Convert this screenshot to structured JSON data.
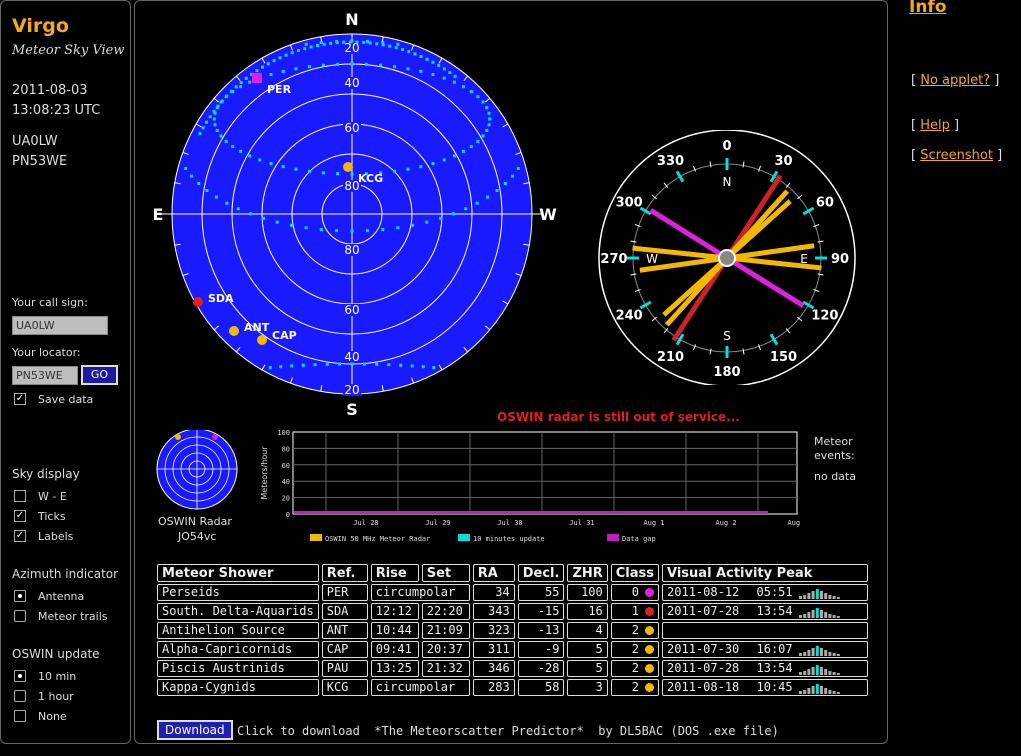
{
  "sidebar": {
    "app_name": "Virgo",
    "app_subtitle": "Meteor Sky View",
    "date": "2011-08-03",
    "time": "13:08:23 UTC",
    "callsign": "UA0LW",
    "locator": "PN53WE",
    "call_sign_label": "Your call sign:",
    "call_sign_value": "UA0LW",
    "locator_label": "Your locator:",
    "locator_value": "PN53WE",
    "go_label": "GO",
    "save_label": "Save data",
    "sky_display_label": "Sky display",
    "sky_options": [
      {
        "label": "W - E",
        "checked": false
      },
      {
        "label": "Ticks",
        "checked": true
      },
      {
        "label": "Labels",
        "checked": true
      }
    ],
    "azimuth_label": "Azimuth indicator",
    "azimuth_options": [
      {
        "label": "Antenna",
        "selected": true
      },
      {
        "label": "Meteor trails",
        "selected": false
      }
    ],
    "oswin_update_label": "OSWIN update",
    "oswin_options": [
      {
        "label": "10 min",
        "selected": true
      },
      {
        "label": "1 hour",
        "selected": false
      },
      {
        "label": "None",
        "selected": false
      }
    ]
  },
  "right": {
    "info_label": "Info",
    "no_applet": "No applet?",
    "help": "Help",
    "screenshot": "Screenshot"
  },
  "skymap": {
    "directions": {
      "n": "N",
      "s": "S",
      "e": "E",
      "w": "W"
    },
    "elevation_labels": [
      "20",
      "40",
      "60",
      "80",
      "80",
      "60",
      "40",
      "20"
    ],
    "radiants": [
      {
        "code": "PER",
        "color": "#e020e0"
      },
      {
        "code": "KCG",
        "color": "#f5b800"
      },
      {
        "code": "SDA",
        "color": "#e02020"
      },
      {
        "code": "ANT",
        "color": "#f5b800"
      },
      {
        "code": "CAP",
        "color": "#f5b800"
      }
    ],
    "colors": {
      "sky": "#1a1aff",
      "grid": "#ffffff",
      "track": "#00e0e0"
    }
  },
  "compass": {
    "degree_labels": [
      "0",
      "30",
      "60",
      "90",
      "120",
      "150",
      "180",
      "210",
      "240",
      "270",
      "300",
      "330"
    ],
    "inner_labels": {
      "n": "N",
      "e": "E",
      "s": "S",
      "w": "W"
    },
    "trails": [
      {
        "name": "magenta",
        "color": "#e020e0"
      },
      {
        "name": "red",
        "color": "#d0202a"
      },
      {
        "name": "yellow",
        "color": "#f5b800"
      }
    ]
  },
  "oswin": {
    "status": "OSWIN radar is still out of service...",
    "radar_label": "OSWIN Radar",
    "radar_locator": "JO54vc",
    "y_axis_label": "Meteors/hour",
    "y_ticks": [
      "100",
      "80",
      "60",
      "40",
      "20",
      "0"
    ],
    "x_ticks": [
      "Jul 28",
      "Jul 29",
      "Jul 30",
      "Jul 31",
      "Aug 1",
      "Aug 2",
      "Aug 3"
    ],
    "legend": [
      {
        "label": "OSWIN 50 MHz Meteor Radar",
        "color": "#f5b800"
      },
      {
        "label": "10 minutes update",
        "color": "#00e0e0"
      },
      {
        "label": "Data gap",
        "color": "#c020c0"
      }
    ],
    "events_label": "Meteor events:",
    "events_value": "no data"
  },
  "table": {
    "headers": [
      "Meteor Shower",
      "Ref.",
      "Rise",
      "Set",
      "RA",
      "Decl.",
      "ZHR",
      "Class",
      "Visual Activity Peak"
    ],
    "rows": [
      {
        "name": "Perseids",
        "ref": "PER",
        "rise": "circumpolar",
        "set": "",
        "ra": "34",
        "decl": "55",
        "zhr": "100",
        "cls": "0",
        "dot": "#e020e0",
        "peak_date": "2011-08-12",
        "peak_time": "05:51"
      },
      {
        "name": "South. Delta-Aquarids",
        "ref": "SDA",
        "rise": "12:12",
        "set": "22:20",
        "ra": "343",
        "decl": "-15",
        "zhr": "16",
        "cls": "1",
        "dot": "#e02020",
        "peak_date": "2011-07-28",
        "peak_time": "13:54"
      },
      {
        "name": "Antihelion Source",
        "ref": "ANT",
        "rise": "10:44",
        "set": "21:09",
        "ra": "323",
        "decl": "-13",
        "zhr": "4",
        "cls": "2",
        "dot": "#f5b800",
        "peak_date": "",
        "peak_time": ""
      },
      {
        "name": "Alpha-Capricornids",
        "ref": "CAP",
        "rise": "09:41",
        "set": "20:37",
        "ra": "311",
        "decl": "-9",
        "zhr": "5",
        "cls": "2",
        "dot": "#f5b800",
        "peak_date": "2011-07-30",
        "peak_time": "16:07"
      },
      {
        "name": "Piscis Austrinids",
        "ref": "PAU",
        "rise": "13:25",
        "set": "21:32",
        "ra": "346",
        "decl": "-28",
        "zhr": "5",
        "cls": "2",
        "dot": "#f5b800",
        "peak_date": "2011-07-28",
        "peak_time": "13:54"
      },
      {
        "name": "Kappa-Cygnids",
        "ref": "KCG",
        "rise": "circumpolar",
        "set": "",
        "ra": "283",
        "decl": "58",
        "zhr": "3",
        "cls": "2",
        "dot": "#f5b800",
        "peak_date": "2011-08-18",
        "peak_time": "10:45"
      }
    ]
  },
  "footer": {
    "download_label": "Download",
    "download_text": "Click to download  *The Meteorscatter Predictor*  by DL5BAC (DOS .exe file)"
  }
}
